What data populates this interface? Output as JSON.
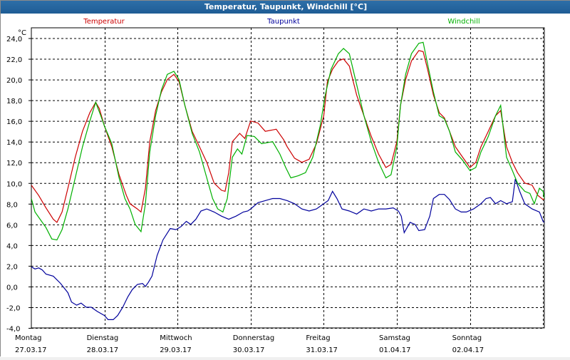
{
  "window": {
    "title": "Temperatur, Taupunkt, Windchill [°C]"
  },
  "chart_data": {
    "type": "line",
    "title": "Temperatur, Taupunkt, Windchill [°C]",
    "ylabel": "°C",
    "xlabel": "",
    "ylim": [
      -4.0,
      25.0
    ],
    "xlim": [
      0,
      7
    ],
    "yticks": [
      "24,0",
      "22,0",
      "20,0",
      "18,0",
      "16,0",
      "14,0",
      "12,0",
      "10,0",
      "8,0",
      "6,0",
      "4,0",
      "2,0",
      "0,0",
      "-2,0",
      "-4,0"
    ],
    "ytick_values": [
      24,
      22,
      20,
      18,
      16,
      14,
      12,
      10,
      8,
      6,
      4,
      2,
      0,
      -2,
      -4
    ],
    "day_labels": [
      {
        "day": "Montag",
        "date": "27.03.17"
      },
      {
        "day": "Dienstag",
        "date": "28.03.17"
      },
      {
        "day": "Mittwoch",
        "date": "29.03.17"
      },
      {
        "day": "Donnerstag",
        "date": "30.03.17"
      },
      {
        "day": "Freitag",
        "date": "31.03.17"
      },
      {
        "day": "Samstag",
        "date": "01.04.17"
      },
      {
        "day": "Sonntag",
        "date": "02.04.17"
      }
    ],
    "grid": true,
    "legend_placement": "top",
    "series": [
      {
        "name": "Temperatur",
        "color": "#cc0000",
        "points": [
          [
            0.0,
            9.8
          ],
          [
            0.1,
            8.8
          ],
          [
            0.2,
            7.6
          ],
          [
            0.3,
            6.5
          ],
          [
            0.35,
            6.2
          ],
          [
            0.42,
            7.2
          ],
          [
            0.5,
            9.5
          ],
          [
            0.6,
            12.5
          ],
          [
            0.7,
            15.0
          ],
          [
            0.8,
            16.8
          ],
          [
            0.88,
            17.8
          ],
          [
            0.93,
            17.2
          ],
          [
            1.0,
            15.5
          ],
          [
            1.1,
            13.5
          ],
          [
            1.2,
            10.8
          ],
          [
            1.3,
            8.8
          ],
          [
            1.35,
            8.0
          ],
          [
            1.45,
            7.5
          ],
          [
            1.5,
            7.2
          ],
          [
            1.56,
            9.5
          ],
          [
            1.62,
            14.0
          ],
          [
            1.7,
            17.0
          ],
          [
            1.78,
            18.8
          ],
          [
            1.86,
            20.0
          ],
          [
            1.95,
            20.5
          ],
          [
            2.02,
            19.8
          ],
          [
            2.1,
            17.5
          ],
          [
            2.2,
            15.0
          ],
          [
            2.3,
            13.5
          ],
          [
            2.4,
            12.0
          ],
          [
            2.5,
            10.0
          ],
          [
            2.6,
            9.3
          ],
          [
            2.65,
            9.2
          ],
          [
            2.7,
            11.0
          ],
          [
            2.75,
            14.0
          ],
          [
            2.85,
            14.8
          ],
          [
            2.92,
            14.3
          ],
          [
            3.0,
            16.0
          ],
          [
            3.1,
            15.8
          ],
          [
            3.2,
            15.0
          ],
          [
            3.35,
            15.2
          ],
          [
            3.45,
            14.2
          ],
          [
            3.5,
            13.5
          ],
          [
            3.6,
            12.4
          ],
          [
            3.7,
            12.0
          ],
          [
            3.8,
            12.3
          ],
          [
            3.9,
            13.8
          ],
          [
            4.0,
            16.5
          ],
          [
            4.05,
            19.8
          ],
          [
            4.12,
            21.0
          ],
          [
            4.2,
            21.8
          ],
          [
            4.27,
            22.0
          ],
          [
            4.35,
            21.3
          ],
          [
            4.45,
            18.5
          ],
          [
            4.55,
            16.5
          ],
          [
            4.65,
            14.5
          ],
          [
            4.75,
            12.8
          ],
          [
            4.85,
            11.5
          ],
          [
            4.92,
            11.8
          ],
          [
            5.0,
            14.0
          ],
          [
            5.05,
            17.5
          ],
          [
            5.12,
            20.0
          ],
          [
            5.2,
            21.8
          ],
          [
            5.3,
            22.8
          ],
          [
            5.36,
            22.7
          ],
          [
            5.42,
            21.0
          ],
          [
            5.5,
            18.5
          ],
          [
            5.58,
            16.8
          ],
          [
            5.65,
            16.3
          ],
          [
            5.72,
            15.0
          ],
          [
            5.8,
            13.5
          ],
          [
            5.9,
            12.5
          ],
          [
            6.0,
            11.5
          ],
          [
            6.08,
            12.0
          ],
          [
            6.15,
            13.5
          ],
          [
            6.25,
            15.0
          ],
          [
            6.35,
            16.5
          ],
          [
            6.42,
            17.0
          ],
          [
            6.5,
            13.5
          ],
          [
            6.58,
            12.0
          ],
          [
            6.65,
            11.0
          ],
          [
            6.75,
            10.0
          ],
          [
            6.85,
            9.8
          ],
          [
            6.93,
            8.8
          ],
          [
            7.0,
            8.4
          ],
          [
            7.06,
            8.8
          ],
          [
            7.12,
            10.5
          ],
          [
            7.2,
            13.5
          ],
          [
            7.28,
            14.2
          ],
          [
            7.35,
            14.0
          ],
          [
            7.45,
            15.2
          ],
          [
            7.55,
            15.6
          ],
          [
            7.63,
            16.1
          ],
          [
            7.72,
            15.2
          ],
          [
            7.8,
            13.8
          ],
          [
            7.88,
            12.5
          ],
          [
            7.95,
            11.8
          ],
          [
            8.0,
            11.3
          ]
        ]
      },
      {
        "name": "Taupunkt",
        "color": "#00009c",
        "points": [
          [
            0.0,
            1.9
          ],
          [
            0.05,
            1.7
          ],
          [
            0.1,
            1.8
          ],
          [
            0.15,
            1.6
          ],
          [
            0.2,
            1.2
          ],
          [
            0.3,
            1.0
          ],
          [
            0.4,
            0.3
          ],
          [
            0.5,
            -0.6
          ],
          [
            0.55,
            -1.5
          ],
          [
            0.62,
            -1.8
          ],
          [
            0.68,
            -1.6
          ],
          [
            0.75,
            -2.0
          ],
          [
            0.82,
            -2.0
          ],
          [
            0.9,
            -2.4
          ],
          [
            1.0,
            -2.8
          ],
          [
            1.05,
            -3.2
          ],
          [
            1.12,
            -3.2
          ],
          [
            1.18,
            -2.8
          ],
          [
            1.25,
            -2.0
          ],
          [
            1.32,
            -1.0
          ],
          [
            1.38,
            -0.3
          ],
          [
            1.45,
            0.2
          ],
          [
            1.52,
            0.3
          ],
          [
            1.56,
            0.0
          ],
          [
            1.6,
            0.4
          ],
          [
            1.65,
            1.0
          ],
          [
            1.72,
            3.0
          ],
          [
            1.8,
            4.5
          ],
          [
            1.9,
            5.6
          ],
          [
            1.98,
            5.5
          ],
          [
            2.05,
            5.8
          ],
          [
            2.12,
            6.3
          ],
          [
            2.18,
            6.0
          ],
          [
            2.25,
            6.5
          ],
          [
            2.32,
            7.3
          ],
          [
            2.4,
            7.5
          ],
          [
            2.5,
            7.2
          ],
          [
            2.6,
            6.8
          ],
          [
            2.7,
            6.5
          ],
          [
            2.8,
            6.8
          ],
          [
            2.9,
            7.2
          ],
          [
            2.96,
            7.3
          ],
          [
            3.0,
            7.5
          ],
          [
            3.1,
            8.1
          ],
          [
            3.2,
            8.3
          ],
          [
            3.3,
            8.5
          ],
          [
            3.4,
            8.5
          ],
          [
            3.5,
            8.3
          ],
          [
            3.6,
            8.0
          ],
          [
            3.7,
            7.5
          ],
          [
            3.8,
            7.3
          ],
          [
            3.9,
            7.5
          ],
          [
            4.0,
            8.0
          ],
          [
            4.06,
            8.3
          ],
          [
            4.12,
            9.2
          ],
          [
            4.18,
            8.5
          ],
          [
            4.25,
            7.5
          ],
          [
            4.35,
            7.3
          ],
          [
            4.45,
            7.0
          ],
          [
            4.55,
            7.5
          ],
          [
            4.65,
            7.3
          ],
          [
            4.75,
            7.5
          ],
          [
            4.85,
            7.5
          ],
          [
            4.95,
            7.6
          ],
          [
            5.02,
            7.3
          ],
          [
            5.06,
            6.8
          ],
          [
            5.1,
            5.2
          ],
          [
            5.18,
            6.2
          ],
          [
            5.25,
            6.0
          ],
          [
            5.3,
            5.4
          ],
          [
            5.38,
            5.5
          ],
          [
            5.45,
            6.8
          ],
          [
            5.5,
            8.5
          ],
          [
            5.58,
            8.9
          ],
          [
            5.65,
            8.9
          ],
          [
            5.72,
            8.4
          ],
          [
            5.8,
            7.5
          ],
          [
            5.88,
            7.2
          ],
          [
            5.95,
            7.2
          ],
          [
            6.05,
            7.5
          ],
          [
            6.15,
            8.0
          ],
          [
            6.22,
            8.5
          ],
          [
            6.28,
            8.6
          ],
          [
            6.35,
            8.0
          ],
          [
            6.42,
            8.3
          ],
          [
            6.5,
            8.0
          ],
          [
            6.58,
            8.2
          ],
          [
            6.62,
            10.4
          ],
          [
            6.68,
            9.2
          ],
          [
            6.75,
            8.0
          ],
          [
            6.85,
            7.5
          ],
          [
            6.95,
            7.2
          ],
          [
            7.0,
            6.3
          ],
          [
            7.1,
            5.8
          ],
          [
            7.18,
            6.0
          ],
          [
            7.25,
            7.3
          ],
          [
            7.32,
            7.8
          ],
          [
            7.4,
            7.2
          ],
          [
            7.5,
            6.5
          ],
          [
            7.58,
            6.0
          ],
          [
            7.65,
            5.0
          ],
          [
            7.72,
            4.5
          ],
          [
            7.78,
            4.4
          ],
          [
            7.85,
            4.6
          ],
          [
            7.92,
            5.8
          ],
          [
            8.0,
            6.4
          ]
        ]
      },
      {
        "name": "Windchill",
        "color": "#00b000",
        "points": [
          [
            0.0,
            8.5
          ],
          [
            0.05,
            7.2
          ],
          [
            0.12,
            6.5
          ],
          [
            0.2,
            5.7
          ],
          [
            0.28,
            4.6
          ],
          [
            0.35,
            4.5
          ],
          [
            0.42,
            5.5
          ],
          [
            0.5,
            7.5
          ],
          [
            0.6,
            10.5
          ],
          [
            0.7,
            13.5
          ],
          [
            0.8,
            16.0
          ],
          [
            0.88,
            17.8
          ],
          [
            0.95,
            16.5
          ],
          [
            1.0,
            15.5
          ],
          [
            1.1,
            13.8
          ],
          [
            1.2,
            10.5
          ],
          [
            1.28,
            8.5
          ],
          [
            1.35,
            7.5
          ],
          [
            1.42,
            6.0
          ],
          [
            1.5,
            5.3
          ],
          [
            1.56,
            8.0
          ],
          [
            1.62,
            13.0
          ],
          [
            1.7,
            16.5
          ],
          [
            1.78,
            19.0
          ],
          [
            1.86,
            20.5
          ],
          [
            1.95,
            20.8
          ],
          [
            2.02,
            20.0
          ],
          [
            2.1,
            17.5
          ],
          [
            2.2,
            14.8
          ],
          [
            2.3,
            13.0
          ],
          [
            2.4,
            10.5
          ],
          [
            2.48,
            8.5
          ],
          [
            2.55,
            7.5
          ],
          [
            2.62,
            7.2
          ],
          [
            2.68,
            8.5
          ],
          [
            2.75,
            12.5
          ],
          [
            2.82,
            13.3
          ],
          [
            2.88,
            12.8
          ],
          [
            2.95,
            14.6
          ],
          [
            3.05,
            14.5
          ],
          [
            3.15,
            13.8
          ],
          [
            3.3,
            14.0
          ],
          [
            3.4,
            12.8
          ],
          [
            3.48,
            11.5
          ],
          [
            3.55,
            10.5
          ],
          [
            3.65,
            10.7
          ],
          [
            3.75,
            11.0
          ],
          [
            3.85,
            12.5
          ],
          [
            3.95,
            15.5
          ],
          [
            4.02,
            18.5
          ],
          [
            4.1,
            21.0
          ],
          [
            4.2,
            22.5
          ],
          [
            4.27,
            23.0
          ],
          [
            4.35,
            22.5
          ],
          [
            4.45,
            19.5
          ],
          [
            4.55,
            16.5
          ],
          [
            4.65,
            14.0
          ],
          [
            4.75,
            12.0
          ],
          [
            4.85,
            10.5
          ],
          [
            4.92,
            10.8
          ],
          [
            5.0,
            13.5
          ],
          [
            5.05,
            17.5
          ],
          [
            5.12,
            20.5
          ],
          [
            5.2,
            22.5
          ],
          [
            5.3,
            23.5
          ],
          [
            5.36,
            23.6
          ],
          [
            5.42,
            21.5
          ],
          [
            5.5,
            18.8
          ],
          [
            5.58,
            16.5
          ],
          [
            5.65,
            16.2
          ],
          [
            5.72,
            15.0
          ],
          [
            5.8,
            13.0
          ],
          [
            5.9,
            12.2
          ],
          [
            6.0,
            11.2
          ],
          [
            6.08,
            11.5
          ],
          [
            6.15,
            13.0
          ],
          [
            6.25,
            14.5
          ],
          [
            6.35,
            16.5
          ],
          [
            6.42,
            17.5
          ],
          [
            6.5,
            12.5
          ],
          [
            6.58,
            11.2
          ],
          [
            6.65,
            10.0
          ],
          [
            6.75,
            9.2
          ],
          [
            6.82,
            9.0
          ],
          [
            6.88,
            8.0
          ],
          [
            6.95,
            9.5
          ],
          [
            7.0,
            9.2
          ],
          [
            7.06,
            7.0
          ],
          [
            7.12,
            7.5
          ],
          [
            7.2,
            12.5
          ],
          [
            7.28,
            14.4
          ],
          [
            7.35,
            14.0
          ],
          [
            7.45,
            15.0
          ],
          [
            7.55,
            15.5
          ],
          [
            7.63,
            16.2
          ],
          [
            7.72,
            15.0
          ],
          [
            7.8,
            13.5
          ],
          [
            7.88,
            12.0
          ],
          [
            7.95,
            10.8
          ],
          [
            8.0,
            10.2
          ]
        ]
      }
    ]
  }
}
